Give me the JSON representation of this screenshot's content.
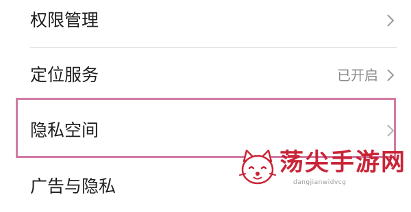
{
  "settings": {
    "items": [
      {
        "label": "权限管理",
        "value": ""
      },
      {
        "label": "定位服务",
        "value": "已开启"
      },
      {
        "label": "隐私空间",
        "value": ""
      },
      {
        "label": "广告与隐私",
        "value": ""
      }
    ]
  },
  "highlight": {
    "color": "#d17ba3"
  },
  "watermark": {
    "brand": "荡尖手游网",
    "url": "dangjianwidvcg",
    "logo_icon": "fox-logo-icon",
    "brand_color": "#c92437"
  },
  "icons": {
    "chevron": "chevron-right-icon"
  }
}
